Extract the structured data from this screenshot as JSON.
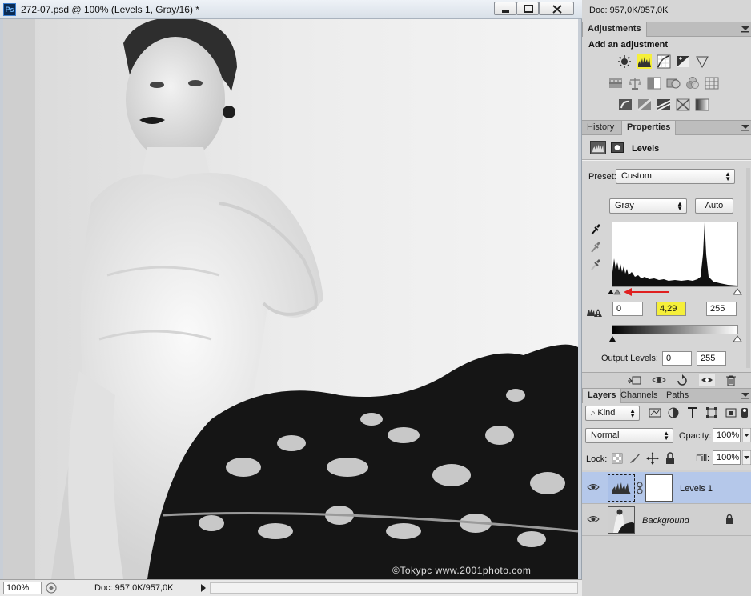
{
  "window": {
    "title": "272-07.psd @ 100% (Levels 1, Gray/16) *",
    "app_icon_label": "Ps"
  },
  "canvas": {
    "watermark": "©Tokypc   www.2001photo.com"
  },
  "status_bar": {
    "zoom": "100%",
    "doc": "Doc: 957,0K/957,0K"
  },
  "info_bar": {
    "doc": "Doc: 957,0K/957,0K"
  },
  "adjustments": {
    "tab": "Adjustments",
    "heading": "Add an adjustment",
    "highlighted_icon": "levels-icon",
    "highlight_color": "#f5ef3a"
  },
  "properties": {
    "tabs": [
      "History",
      "Properties"
    ],
    "active_tab": "Properties",
    "title": "Levels",
    "preset_label": "Preset:",
    "preset_value": "Custom",
    "channel_value": "Gray",
    "auto_label": "Auto",
    "input_black": "0",
    "input_gamma": "4,29",
    "input_white": "255",
    "output_label": "Output Levels:",
    "output_black": "0",
    "output_white": "255"
  },
  "layers": {
    "tabs": [
      "Layers",
      "Channels",
      "Paths"
    ],
    "active_tab": "Layers",
    "kind_label": "Kind",
    "blend_mode": "Normal",
    "opacity_label": "Opacity:",
    "opacity_value": "100%",
    "lock_label": "Lock:",
    "fill_label": "Fill:",
    "fill_value": "100%",
    "items": [
      {
        "name": "Levels 1",
        "selected": true
      },
      {
        "name": "Background",
        "selected": false
      }
    ]
  }
}
